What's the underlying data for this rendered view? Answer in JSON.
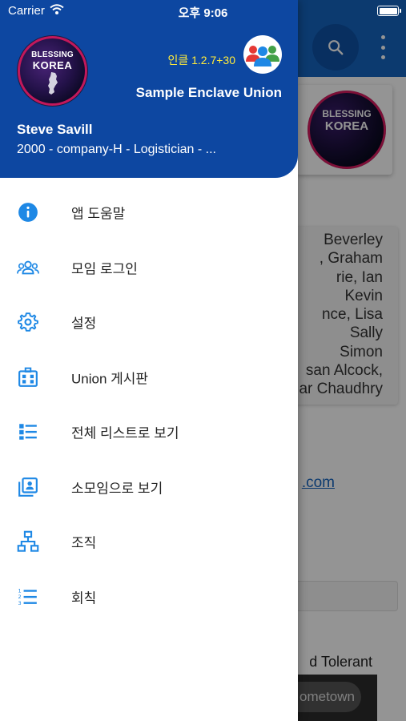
{
  "status_bar": {
    "carrier": "Carrier",
    "time": "오후 9:06"
  },
  "drawer": {
    "version": "인클 1.2.7+30",
    "union_name": "Sample Enclave Union",
    "user_name": "Steve Savill",
    "user_detail": "2000 - company-H - Logistician - ...",
    "logo_line1": "BLESSING",
    "logo_line2": "KOREA",
    "items": [
      {
        "label": "앱 도움말",
        "icon": "info-icon"
      },
      {
        "label": "모임 로그인",
        "icon": "group-icon"
      },
      {
        "label": "설정",
        "icon": "gear-icon"
      },
      {
        "label": "Union 게시판",
        "icon": "board-icon"
      },
      {
        "label": "전체 리스트로 보기",
        "icon": "list-view-icon"
      },
      {
        "label": "소모임으로 보기",
        "icon": "contact-book-icon"
      },
      {
        "label": "조직",
        "icon": "org-chart-icon"
      },
      {
        "label": "회칙",
        "icon": "numbered-list-icon"
      }
    ]
  },
  "background": {
    "logo_line1": "BLESSING",
    "logo_line2": "KOREA",
    "names_lines": [
      "Beverley",
      ", Graham",
      "rie, Ian",
      "Kevin",
      "nce, Lisa",
      "Sally",
      "Simon",
      "san Alcock,",
      "ar Chaudhry"
    ],
    "email_fragment": ".com",
    "tolerant_text": "d Tolerant",
    "chip_text": "ometown"
  },
  "colors": {
    "accent": "#1e88e5",
    "header_bg": "#0d47a1",
    "version_text": "#ffeb3b"
  }
}
